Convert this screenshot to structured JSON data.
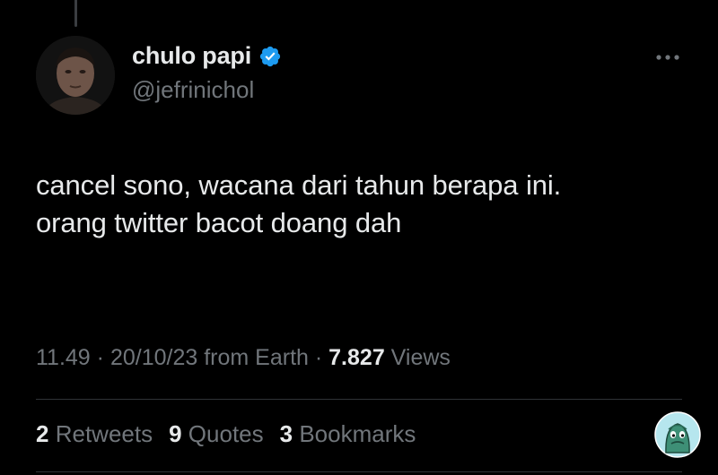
{
  "profile": {
    "display_name": "chulo papi",
    "handle": "@jefrinichol",
    "verified": true
  },
  "tweet": {
    "lines": [
      "cancel sono, wacana dari tahun berapa ini.",
      "orang twitter bacot doang dah"
    ]
  },
  "meta": {
    "time": "11.49",
    "separator": "·",
    "date": "20/10/23 from Earth",
    "views_count": "7.827",
    "views_label": "Views"
  },
  "stats": {
    "retweets": {
      "count": "2",
      "label": "Retweets"
    },
    "quotes": {
      "count": "9",
      "label": "Quotes"
    },
    "bookmarks": {
      "count": "3",
      "label": "Bookmarks"
    }
  },
  "icons": {
    "verified": "verified-badge-icon",
    "more": "more-options-icon",
    "mascot": "mascot-sticker-icon"
  },
  "colors": {
    "background": "#000000",
    "text": "#e7e9ea",
    "secondary": "#71767b",
    "verified": "#1d9bf0",
    "divider": "#2f3336"
  }
}
